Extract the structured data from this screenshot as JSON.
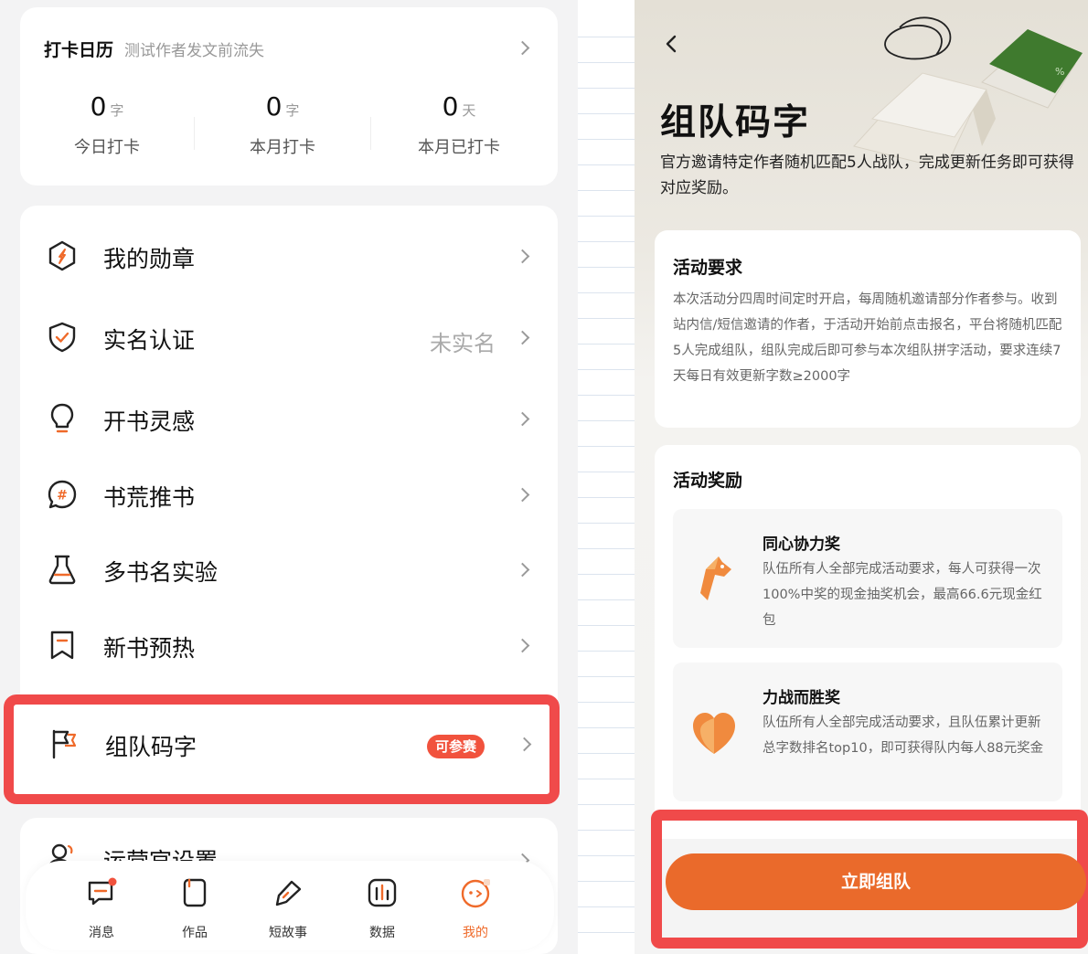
{
  "checkin": {
    "title": "打卡日历",
    "subtitle": "测试作者发文前流失",
    "stats": [
      {
        "num": "0",
        "unit": "字",
        "label": "今日打卡"
      },
      {
        "num": "0",
        "unit": "字",
        "label": "本月打卡"
      },
      {
        "num": "0",
        "unit": "天",
        "label": "本月已打卡"
      }
    ]
  },
  "menu": {
    "items": [
      {
        "label": "我的勋章",
        "icon": "medal-icon",
        "right": ""
      },
      {
        "label": "实名认证",
        "icon": "shield-check-icon",
        "right": "未实名"
      },
      {
        "label": "开书灵感",
        "icon": "lightbulb-icon",
        "right": ""
      },
      {
        "label": "书荒推书",
        "icon": "hashtag-bubble-icon",
        "right": ""
      },
      {
        "label": "多书名实验",
        "icon": "flask-icon",
        "right": ""
      },
      {
        "label": "新书预热",
        "icon": "bookmark-icon",
        "right": ""
      }
    ],
    "team": {
      "label": "组队码字",
      "icon": "flag-icon",
      "badge": "可参赛"
    },
    "operator": {
      "label": "运营官设置",
      "icon": "user-settings-icon"
    }
  },
  "tabbar": {
    "tabs": [
      {
        "label": "消息",
        "icon": "message-icon"
      },
      {
        "label": "作品",
        "icon": "works-icon"
      },
      {
        "label": "短故事",
        "icon": "pen-icon"
      },
      {
        "label": "数据",
        "icon": "chart-icon"
      },
      {
        "label": "我的",
        "icon": "profile-icon"
      }
    ],
    "active": "我的"
  },
  "activity": {
    "title": "组队码字",
    "desc": "官方邀请特定作者随机匹配5人战队，完成更新任务即可获得对应奖励。",
    "requirement": {
      "title": "活动要求",
      "body": "本次活动分四周时间定时开启，每周随机邀请部分作者参与。收到站内信/短信邀请的作者，于活动开始前点击报名，平台将随机匹配5人完成组队，组队完成后即可参与本次组队拼字活动，要求连续7天每日有效更新字数≥2000字"
    },
    "reward": {
      "title": "活动奖励",
      "prizes": [
        {
          "name": "同心协力奖",
          "desc": "队伍所有人全部完成活动要求，每人可获得一次100%中奖的现金抽奖机会，最高66.6元现金红包",
          "icon": "horse-icon"
        },
        {
          "name": "力战而胜奖",
          "desc": "队伍所有人全部完成活动要求，且队伍累计更新总字数排名top10，即可获得队内每人88元奖金",
          "icon": "heart-icon"
        }
      ]
    },
    "join_button": "立即组队"
  },
  "colors": {
    "accent": "#ea6a2b",
    "badge": "#f1523d",
    "highlight": "#f04a4a"
  }
}
